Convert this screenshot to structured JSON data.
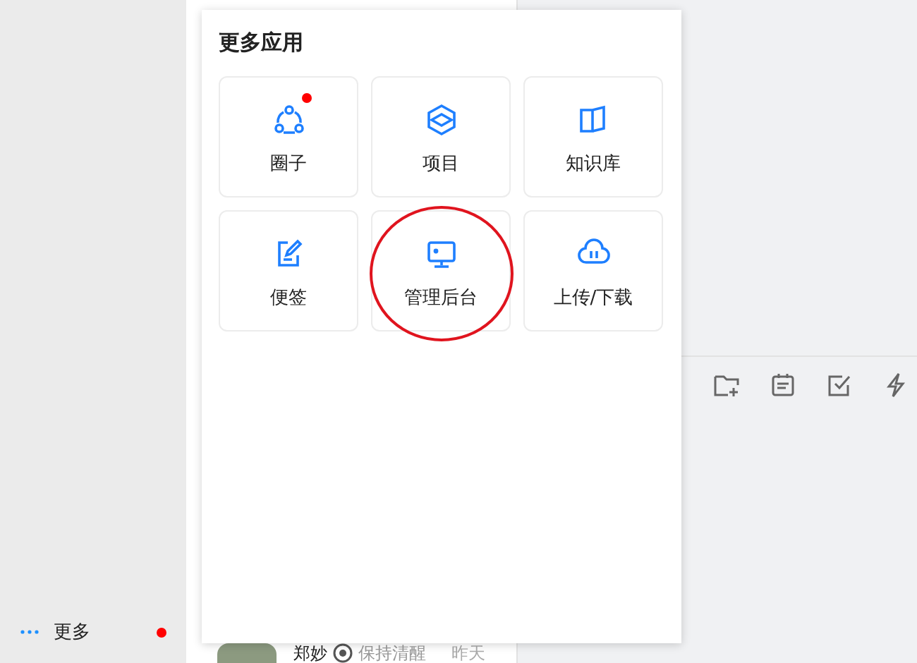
{
  "sidebar": {
    "more_item": {
      "label": "更多",
      "badge": true
    }
  },
  "conversation": {
    "name": "郑妙",
    "status": "保持清醒",
    "time": "昨天"
  },
  "popup": {
    "title": "更多应用",
    "apps": [
      {
        "kind": "circle",
        "label": "圈子",
        "badge": true,
        "circled": false
      },
      {
        "kind": "project",
        "label": "项目",
        "badge": false,
        "circled": false
      },
      {
        "kind": "knowledge",
        "label": "知识库",
        "badge": false,
        "circled": false
      },
      {
        "kind": "note",
        "label": "便签",
        "badge": false,
        "circled": false
      },
      {
        "kind": "admin",
        "label": "管理后台",
        "badge": false,
        "circled": true
      },
      {
        "kind": "transfer",
        "label": "上传/下载",
        "badge": false,
        "circled": false
      }
    ]
  }
}
